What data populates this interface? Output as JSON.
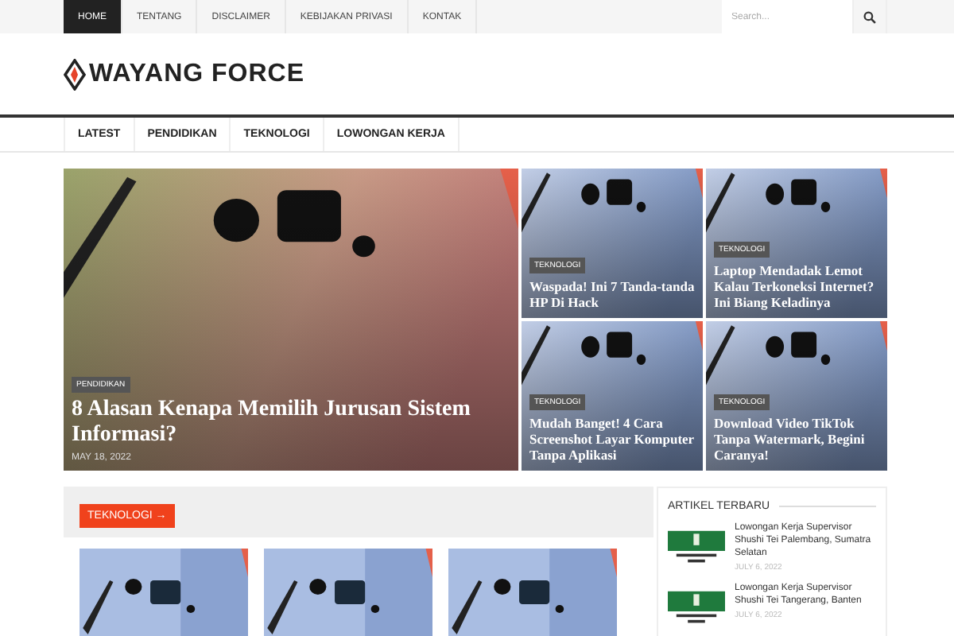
{
  "top_menu": [
    {
      "label": "HOME",
      "selected": true
    },
    {
      "label": "TENTANG",
      "selected": false
    },
    {
      "label": "DISCLAIMER",
      "selected": false
    },
    {
      "label": "KEBIJAKAN PRIVASI",
      "selected": false
    },
    {
      "label": "KONTAK",
      "selected": false
    }
  ],
  "search": {
    "placeholder": "Search..."
  },
  "logo": {
    "text": "WAYANG FORCE"
  },
  "main_menu": [
    "LATEST",
    "PENDIDIKAN",
    "TEKNOLOGI",
    "LOWONGAN KERJA"
  ],
  "featured": [
    {
      "category": "PENDIDIKAN",
      "title": "8 Alasan Kenapa Memilih Jurusan Sistem Informasi?",
      "date": "MAY 18, 2022",
      "kind": "picture"
    },
    {
      "category": "TEKNOLOGI",
      "title": "Waspada! Ini 7 Tanda-tanda HP Di Hack",
      "kind": "picture"
    },
    {
      "category": "TEKNOLOGI",
      "title": "Laptop Mendadak Lemot Kalau Terkoneksi Internet? Ini Biang Keladinya",
      "kind": "picture"
    },
    {
      "category": "TEKNOLOGI",
      "title": "Mudah Banget! 4 Cara Screenshot Layar Komputer Tanpa Aplikasi",
      "kind": "picture"
    },
    {
      "category": "TEKNOLOGI",
      "title": "Download Video TikTok Tanpa Watermark, Begini Caranya!",
      "kind": "picture"
    }
  ],
  "section": {
    "title": "TEKNOLOGI →"
  },
  "sidebar": {
    "title": "ARTIKEL TERBARU",
    "items": [
      {
        "title": "Lowongan Kerja Supervisor Shushi Tei Palembang, Sumatra Selatan",
        "date": "JULY 6, 2022"
      },
      {
        "title": "Lowongan Kerja Supervisor Shushi Tei Tangerang, Banten",
        "date": "JULY 6, 2022"
      }
    ]
  }
}
